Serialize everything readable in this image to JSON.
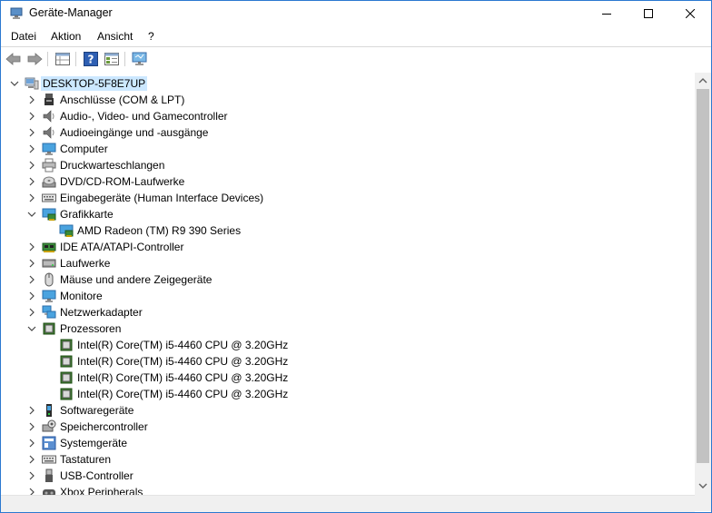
{
  "window": {
    "title": "Geräte-Manager"
  },
  "menu": [
    "Datei",
    "Aktion",
    "Ansicht",
    "?"
  ],
  "tree": {
    "root": "DESKTOP-5F8E7UP",
    "items": [
      {
        "label": "Anschlüsse (COM & LPT)",
        "icon": "port-icon",
        "expanded": false
      },
      {
        "label": "Audio-, Video- und Gamecontroller",
        "icon": "speaker-icon",
        "expanded": false
      },
      {
        "label": "Audioeingänge und -ausgänge",
        "icon": "speaker-icon",
        "expanded": false
      },
      {
        "label": "Computer",
        "icon": "monitor-icon",
        "expanded": false
      },
      {
        "label": "Druckwarteschlangen",
        "icon": "printer-icon",
        "expanded": false
      },
      {
        "label": "DVD/CD-ROM-Laufwerke",
        "icon": "disc-icon",
        "expanded": false
      },
      {
        "label": "Eingabegeräte (Human Interface Devices)",
        "icon": "keyboard-icon",
        "expanded": false
      },
      {
        "label": "Grafikkarte",
        "icon": "display-adapter-icon",
        "expanded": true,
        "children": [
          {
            "label": "AMD Radeon (TM) R9 390 Series",
            "icon": "display-adapter-icon"
          }
        ]
      },
      {
        "label": "IDE ATA/ATAPI-Controller",
        "icon": "ide-icon",
        "expanded": false
      },
      {
        "label": "Laufwerke",
        "icon": "drive-icon",
        "expanded": false
      },
      {
        "label": "Mäuse und andere Zeigegeräte",
        "icon": "mouse-icon",
        "expanded": false
      },
      {
        "label": "Monitore",
        "icon": "monitor-icon",
        "expanded": false
      },
      {
        "label": "Netzwerkadapter",
        "icon": "network-icon",
        "expanded": false
      },
      {
        "label": "Prozessoren",
        "icon": "cpu-icon",
        "expanded": true,
        "children": [
          {
            "label": "Intel(R) Core(TM) i5-4460  CPU @ 3.20GHz",
            "icon": "cpu-icon"
          },
          {
            "label": "Intel(R) Core(TM) i5-4460  CPU @ 3.20GHz",
            "icon": "cpu-icon"
          },
          {
            "label": "Intel(R) Core(TM) i5-4460  CPU @ 3.20GHz",
            "icon": "cpu-icon"
          },
          {
            "label": "Intel(R) Core(TM) i5-4460  CPU @ 3.20GHz",
            "icon": "cpu-icon"
          }
        ]
      },
      {
        "label": "Softwaregeräte",
        "icon": "software-device-icon",
        "expanded": false
      },
      {
        "label": "Speichercontroller",
        "icon": "storage-controller-icon",
        "expanded": false
      },
      {
        "label": "Systemgeräte",
        "icon": "system-device-icon",
        "expanded": false
      },
      {
        "label": "Tastaturen",
        "icon": "keyboard-icon",
        "expanded": false
      },
      {
        "label": "USB-Controller",
        "icon": "usb-icon",
        "expanded": false
      },
      {
        "label": "Xbox Peripherals",
        "icon": "xbox-icon",
        "expanded": false
      }
    ]
  },
  "colors": {
    "selection": "#cce8ff",
    "accent": "#2b79d0"
  }
}
